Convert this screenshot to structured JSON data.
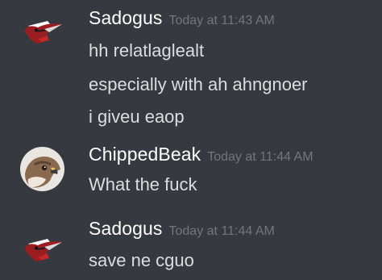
{
  "messages": [
    {
      "username": "Sadogus",
      "timestamp": "Today at 11:43 AM",
      "avatar_icon": "woodpecker-avatar-icon",
      "lines": [
        "hh relatlaglealt",
        "especially with ah ahngnoer",
        "i giveu eaop"
      ]
    },
    {
      "username": "ChippedBeak",
      "timestamp": "Today at 11:44 AM",
      "avatar_icon": "hawk-avatar-icon",
      "lines": [
        "What the fuck"
      ]
    },
    {
      "username": "Sadogus",
      "timestamp": "Today at 11:44 AM",
      "avatar_icon": "woodpecker-avatar-icon",
      "lines": [
        "save ne cguo"
      ]
    }
  ],
  "colors": {
    "background": "#36393f",
    "username": "#ffffff",
    "timestamp": "#72767d",
    "message_text": "#dcddde"
  }
}
